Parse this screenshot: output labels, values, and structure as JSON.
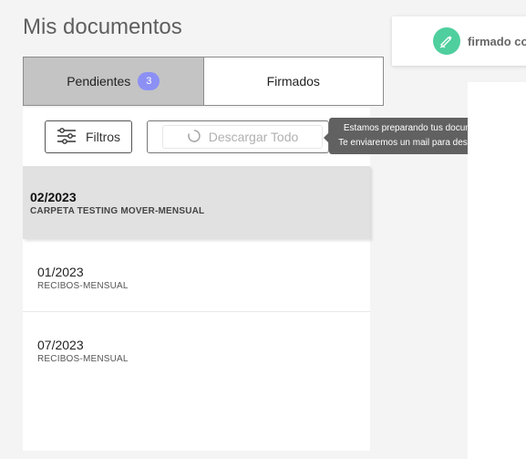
{
  "page": {
    "title": "Mis documentos"
  },
  "tabs": [
    {
      "label": "Pendientes",
      "badge": "3",
      "active": true
    },
    {
      "label": "Firmados",
      "active": false
    }
  ],
  "toolbar": {
    "filter_label": "Filtros",
    "download_label": "Descargar Todo",
    "filter_icon": "sliders-icon",
    "download_icon": "spinner-icon"
  },
  "tooltip": {
    "line1": "Estamos preparando tus documentos",
    "line2": "Te enviaremos un mail para descargarlo"
  },
  "documents": [
    {
      "date": "02/2023",
      "label": "CARPETA TESTING MOVER-MENSUAL",
      "selected": true
    },
    {
      "date": "01/2023",
      "label": "RECIBOS-MENSUAL",
      "selected": false
    },
    {
      "date": "07/2023",
      "label": "RECIBOS-MENSUAL",
      "selected": false
    }
  ],
  "status_card": {
    "text": "firmado co",
    "icon": "signature-pen-icon",
    "color": "#4fcf9e"
  },
  "colors": {
    "badge": "#8c90f5",
    "tooltip": "#616161",
    "active_tab": "#c4c4c4"
  }
}
